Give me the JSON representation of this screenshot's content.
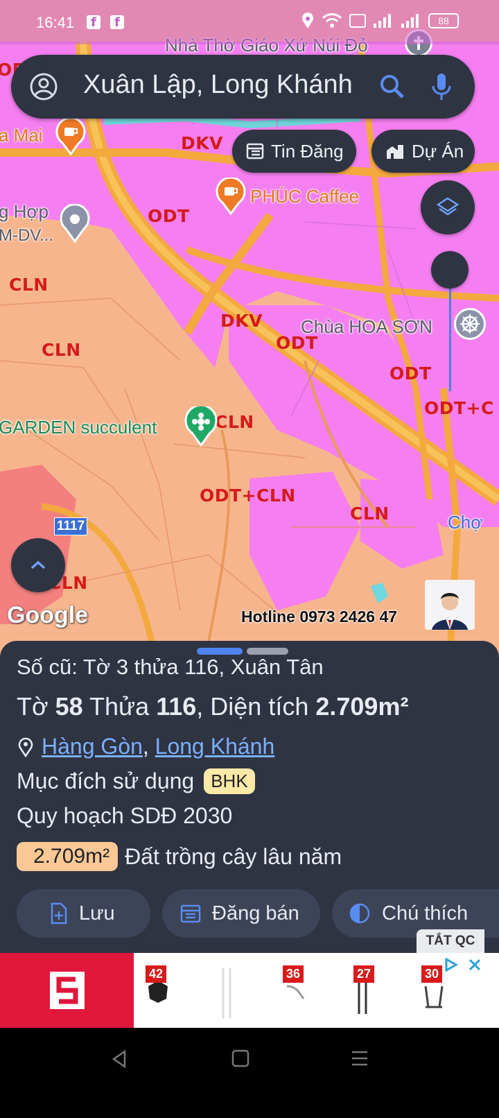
{
  "status_bar": {
    "time": "16:41",
    "battery": "88"
  },
  "search": {
    "query": "Xuân Lập, Long Khánh"
  },
  "chips": {
    "tin_dang": "Tin Đăng",
    "du_an": "Dự Án"
  },
  "map": {
    "zone_labels": [
      "ODT",
      "DKV",
      "ODT",
      "CLN",
      "CLN",
      "DKV",
      "ODT",
      "ODT",
      "ODT+C",
      "CLN",
      "ODT+CLN",
      "CLN",
      "CLN"
    ],
    "pois": {
      "church": "Nhà Thờ Giáo Xứ Núi Đỏ",
      "cafe_mai": "a Mai",
      "phuc_caffee": "PHÚC Caffee",
      "tong_hop_1": "g Hợp",
      "tong_hop_2": "M-DV...",
      "pagoda": "Chùa HOA SƠN",
      "garden": "GARDEN succulent",
      "cho": "Chợ",
      "road_shield": "1117"
    },
    "hotline": "Hotline 0973 2426 47",
    "google_logo": "Google"
  },
  "sheet": {
    "old_ref": "Số cũ: Tờ 3 thửa 116, Xuân Tân",
    "parcel": {
      "to_label": "Tờ",
      "to_value": "58",
      "thua_label": "Thửa",
      "thua_value": "116",
      "area_label": ", Diện tích",
      "area_value": "2.709m²"
    },
    "location": {
      "ward": "Hàng Gòn",
      "separator": ",",
      "city": "Long Khánh"
    },
    "purpose_label": "Mục đích sử dụng",
    "purpose_code": "BHK",
    "plan_label": "Quy hoạch SDĐ 2030",
    "plan_area": "2.709m²",
    "plan_type": "Đất trồng cây lâu năm",
    "buttons": {
      "save": "Lưu",
      "sell": "Đăng bán",
      "legend": "Chú thích"
    }
  },
  "ad": {
    "close_label": "TẮT QC",
    "prices": [
      "42",
      "36",
      "27",
      "30"
    ]
  },
  "colors": {
    "zone_pink": "#f57ff0",
    "zone_peach": "#f7b58e",
    "road_orange": "#f4a93e",
    "sheet_bg": "#2f3442",
    "link_blue": "#7ab0ff"
  }
}
